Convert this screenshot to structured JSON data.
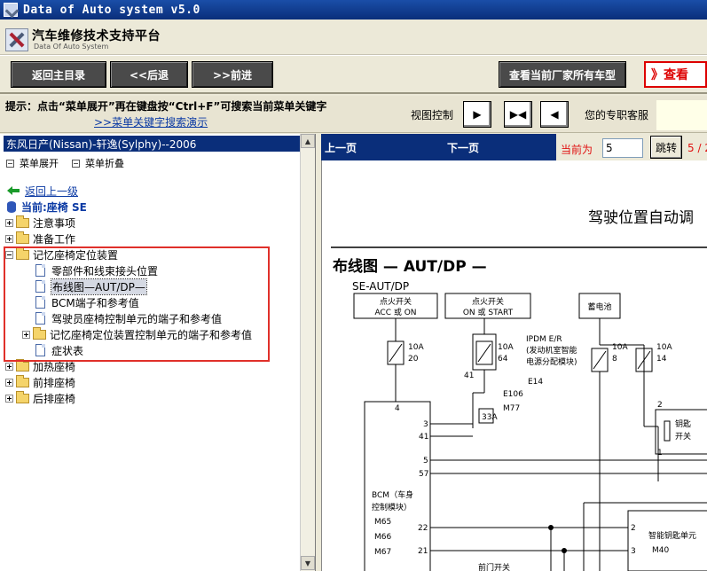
{
  "window": {
    "title": "Data of Auto system v5.0"
  },
  "header": {
    "brand": "汽车维修技术支持平台",
    "brand_sub": "Data Of Auto System"
  },
  "toolbar": {
    "home": "返回主目录",
    "back": "<<后退",
    "forward": ">>前进",
    "all_models": "查看当前厂家所有车型",
    "hot_link": "》查看"
  },
  "hint": {
    "text": "提示：点击“菜单展开”再在键盘按“Ctrl+F”可搜索当前菜单关键字",
    "demo_link": ">>菜单关键字搜索演示",
    "view_control": "视图控制",
    "service": "您的专职客服"
  },
  "left_panel": {
    "vehicle": "东风日产(Nissan)-轩逸(Sylphy)--2006",
    "expand": "菜单展开",
    "collapse": "菜单折叠",
    "back_link": "返回上一级",
    "current": "当前:座椅 SE",
    "tree": [
      {
        "label": "注意事项"
      },
      {
        "label": "准备工作"
      },
      {
        "label": "记忆座椅定位装置"
      },
      {
        "label": "零部件和线束接头位置"
      },
      {
        "label": "布线图—AUT/DP—"
      },
      {
        "label": "BCM端子和参考值"
      },
      {
        "label": "驾驶员座椅控制单元的端子和参考值"
      },
      {
        "label": "记忆座椅定位装置控制单元的端子和参考值"
      },
      {
        "label": "症状表"
      },
      {
        "label": "加热座椅"
      },
      {
        "label": "前排座椅"
      },
      {
        "label": "后排座椅"
      }
    ]
  },
  "right_panel": {
    "prev": "上一页",
    "next": "下一页",
    "current_label": "当前为",
    "page_value": "5",
    "jump": "跳转",
    "total": "5 / 2"
  },
  "diagram": {
    "heading": "驾驶位置自动调",
    "title": "布线图 — AUT/DP —",
    "code": "SE-AUT/DP",
    "ign_acc_on": [
      "点火开关",
      "ACC 或 ON"
    ],
    "ign_on_start": [
      "点火开关",
      "ON 或 START"
    ],
    "battery": "蓄电池",
    "fuse1": [
      "10A",
      "20"
    ],
    "fuse2": [
      "10A",
      "64"
    ],
    "fuse3": [
      "10A",
      "8"
    ],
    "fuse4": [
      "10A",
      "14"
    ],
    "ipdm": [
      "IPDM E/R",
      "(发动机室智能",
      "电源分配模块)"
    ],
    "e14": "E14",
    "pin41": "41",
    "e106": "E106",
    "c33a": "33A",
    "m77": "M77",
    "pins": [
      "4",
      "3",
      "41",
      "5",
      "57",
      "22",
      "21"
    ],
    "bcm": [
      "BCM（车身",
      "控制模块）"
    ],
    "m65": "M65",
    "m66": "M66",
    "m67": "M67",
    "key_switch": [
      "钥匙",
      "开关"
    ],
    "key_pins": [
      "2",
      "1"
    ],
    "smart_key": "智能钥匙单元",
    "sk_pins": [
      "2",
      "3"
    ],
    "m40": "M40",
    "door_switch": "前门开关"
  }
}
